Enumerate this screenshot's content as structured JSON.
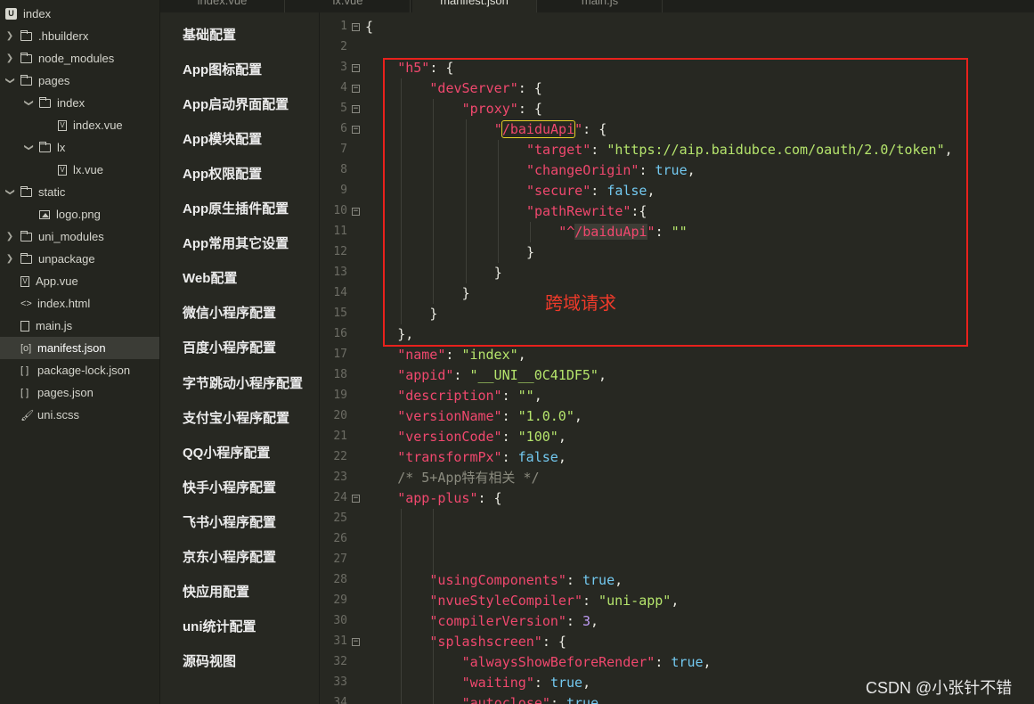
{
  "tabs": [
    {
      "label": "index.vue",
      "active": false
    },
    {
      "label": "lx.vue",
      "active": false
    },
    {
      "label": "manifest.json",
      "active": true
    },
    {
      "label": "main.js",
      "active": false
    }
  ],
  "file_tree": [
    {
      "label": "index",
      "icon": "project-root-icon",
      "depth": 0,
      "twisty": "none",
      "selected": false
    },
    {
      "label": ".hbuilderx",
      "icon": "folder-icon",
      "depth": 0,
      "twisty": "collapsed",
      "selected": false
    },
    {
      "label": "node_modules",
      "icon": "folder-icon",
      "depth": 0,
      "twisty": "collapsed",
      "selected": false
    },
    {
      "label": "pages",
      "icon": "folder-icon",
      "depth": 0,
      "twisty": "expanded",
      "selected": false
    },
    {
      "label": "index",
      "icon": "folder-icon",
      "depth": 1,
      "twisty": "expanded",
      "selected": false
    },
    {
      "label": "index.vue",
      "icon": "vue-file-icon",
      "depth": 2,
      "twisty": "none",
      "selected": false
    },
    {
      "label": "lx",
      "icon": "folder-icon",
      "depth": 1,
      "twisty": "expanded",
      "selected": false
    },
    {
      "label": "lx.vue",
      "icon": "vue-file-icon",
      "depth": 2,
      "twisty": "none",
      "selected": false
    },
    {
      "label": "static",
      "icon": "folder-icon",
      "depth": 0,
      "twisty": "expanded",
      "selected": false
    },
    {
      "label": "logo.png",
      "icon": "image-file-icon",
      "depth": 1,
      "twisty": "none",
      "selected": false
    },
    {
      "label": "uni_modules",
      "icon": "folder-icon",
      "depth": 0,
      "twisty": "collapsed",
      "selected": false
    },
    {
      "label": "unpackage",
      "icon": "folder-icon",
      "depth": 0,
      "twisty": "collapsed",
      "selected": false
    },
    {
      "label": "App.vue",
      "icon": "vue-file-icon",
      "depth": 0,
      "twisty": "none",
      "selected": false
    },
    {
      "label": "index.html",
      "icon": "html-file-icon",
      "depth": 0,
      "twisty": "none",
      "selected": false
    },
    {
      "label": "main.js",
      "icon": "js-file-icon",
      "depth": 0,
      "twisty": "none",
      "selected": false
    },
    {
      "label": "manifest.json",
      "icon": "manifest-file-icon",
      "depth": 0,
      "twisty": "none",
      "selected": true
    },
    {
      "label": "package-lock.json",
      "icon": "json-file-icon",
      "depth": 0,
      "twisty": "none",
      "selected": false
    },
    {
      "label": "pages.json",
      "icon": "json-file-icon",
      "depth": 0,
      "twisty": "none",
      "selected": false
    },
    {
      "label": "uni.scss",
      "icon": "scss-file-icon",
      "depth": 0,
      "twisty": "none",
      "selected": false
    }
  ],
  "settings_nav": [
    "基础配置",
    "App图标配置",
    "App启动界面配置",
    "App模块配置",
    "App权限配置",
    "App原生插件配置",
    "App常用其它设置",
    "Web配置",
    "微信小程序配置",
    "百度小程序配置",
    "字节跳动小程序配置",
    "支付宝小程序配置",
    "QQ小程序配置",
    "快手小程序配置",
    "飞书小程序配置",
    "京东小程序配置",
    "快应用配置",
    "uni统计配置",
    "源码视图"
  ],
  "editor": {
    "lines": [
      {
        "n": "1",
        "fold": true,
        "indent": 0,
        "tokens": [
          [
            "punc",
            "{"
          ]
        ]
      },
      {
        "n": "2",
        "fold": false,
        "indent": 0,
        "tokens": []
      },
      {
        "n": "3",
        "fold": true,
        "indent": 1,
        "tokens": [
          [
            "key",
            "\"h5\""
          ],
          [
            "punc",
            ": {"
          ]
        ]
      },
      {
        "n": "4",
        "fold": true,
        "indent": 2,
        "tokens": [
          [
            "key",
            "\"devServer\""
          ],
          [
            "punc",
            ": {"
          ]
        ]
      },
      {
        "n": "5",
        "fold": true,
        "indent": 3,
        "tokens": [
          [
            "key",
            "\"proxy\""
          ],
          [
            "punc",
            ": {"
          ]
        ]
      },
      {
        "n": "6",
        "fold": true,
        "indent": 4,
        "tokens": [
          [
            "key",
            "\""
          ],
          [
            "keybox",
            "/baiduApi"
          ],
          [
            "key",
            "\""
          ],
          [
            "punc",
            ": {"
          ]
        ]
      },
      {
        "n": "7",
        "fold": false,
        "indent": 5,
        "tokens": [
          [
            "key",
            "\"target\""
          ],
          [
            "punc",
            ": "
          ],
          [
            "str",
            "\"https://aip.baidubce.com/oauth/2.0/token\""
          ],
          [
            "punc",
            ","
          ]
        ]
      },
      {
        "n": "8",
        "fold": false,
        "indent": 5,
        "tokens": [
          [
            "key",
            "\"changeOrigin\""
          ],
          [
            "punc",
            ": "
          ],
          [
            "bool",
            "true"
          ],
          [
            "punc",
            ","
          ]
        ]
      },
      {
        "n": "9",
        "fold": false,
        "indent": 5,
        "tokens": [
          [
            "key",
            "\"secure\""
          ],
          [
            "punc",
            ": "
          ],
          [
            "bool",
            "false"
          ],
          [
            "punc",
            ","
          ]
        ]
      },
      {
        "n": "10",
        "fold": true,
        "indent": 5,
        "tokens": [
          [
            "key",
            "\"pathRewrite\""
          ],
          [
            "punc",
            ":{"
          ]
        ]
      },
      {
        "n": "11",
        "fold": false,
        "indent": 6,
        "tokens": [
          [
            "key",
            "\"^"
          ],
          [
            "keybg",
            "/baiduApi"
          ],
          [
            "key",
            "\""
          ],
          [
            "punc",
            ": "
          ],
          [
            "str",
            "\"\""
          ]
        ]
      },
      {
        "n": "12",
        "fold": false,
        "indent": 5,
        "tokens": [
          [
            "punc",
            "}"
          ]
        ]
      },
      {
        "n": "13",
        "fold": false,
        "indent": 4,
        "tokens": [
          [
            "punc",
            "}"
          ]
        ]
      },
      {
        "n": "14",
        "fold": false,
        "indent": 3,
        "tokens": [
          [
            "punc",
            "}"
          ]
        ]
      },
      {
        "n": "15",
        "fold": false,
        "indent": 2,
        "tokens": [
          [
            "punc",
            "}"
          ]
        ]
      },
      {
        "n": "16",
        "fold": false,
        "indent": 1,
        "tokens": [
          [
            "punc",
            "},"
          ]
        ]
      },
      {
        "n": "17",
        "fold": false,
        "indent": 1,
        "tokens": [
          [
            "key",
            "\"name\""
          ],
          [
            "punc",
            ": "
          ],
          [
            "str",
            "\"index\""
          ],
          [
            "punc",
            ","
          ]
        ]
      },
      {
        "n": "18",
        "fold": false,
        "indent": 1,
        "tokens": [
          [
            "key",
            "\"appid\""
          ],
          [
            "punc",
            ": "
          ],
          [
            "str",
            "\"__UNI__0C41DF5\""
          ],
          [
            "punc",
            ","
          ]
        ]
      },
      {
        "n": "19",
        "fold": false,
        "indent": 1,
        "tokens": [
          [
            "key",
            "\"description\""
          ],
          [
            "punc",
            ": "
          ],
          [
            "str",
            "\"\""
          ],
          [
            "punc",
            ","
          ]
        ]
      },
      {
        "n": "20",
        "fold": false,
        "indent": 1,
        "tokens": [
          [
            "key",
            "\"versionName\""
          ],
          [
            "punc",
            ": "
          ],
          [
            "str",
            "\"1.0.0\""
          ],
          [
            "punc",
            ","
          ]
        ]
      },
      {
        "n": "21",
        "fold": false,
        "indent": 1,
        "tokens": [
          [
            "key",
            "\"versionCode\""
          ],
          [
            "punc",
            ": "
          ],
          [
            "str",
            "\"100\""
          ],
          [
            "punc",
            ","
          ]
        ]
      },
      {
        "n": "22",
        "fold": false,
        "indent": 1,
        "tokens": [
          [
            "key",
            "\"transformPx\""
          ],
          [
            "punc",
            ": "
          ],
          [
            "bool",
            "false"
          ],
          [
            "punc",
            ","
          ]
        ]
      },
      {
        "n": "23",
        "fold": false,
        "indent": 1,
        "tokens": [
          [
            "comment",
            "/* 5+App特有相关 */"
          ]
        ]
      },
      {
        "n": "24",
        "fold": true,
        "indent": 1,
        "tokens": [
          [
            "key",
            "\"app-plus\""
          ],
          [
            "punc",
            ": {"
          ]
        ]
      },
      {
        "n": "25",
        "fold": false,
        "indent": 2,
        "tokens": []
      },
      {
        "n": "26",
        "fold": false,
        "indent": 2,
        "tokens": []
      },
      {
        "n": "27",
        "fold": false,
        "indent": 2,
        "tokens": []
      },
      {
        "n": "28",
        "fold": false,
        "indent": 2,
        "tokens": [
          [
            "key",
            "\"usingComponents\""
          ],
          [
            "punc",
            ": "
          ],
          [
            "bool",
            "true"
          ],
          [
            "punc",
            ","
          ]
        ]
      },
      {
        "n": "29",
        "fold": false,
        "indent": 2,
        "tokens": [
          [
            "key",
            "\"nvueStyleCompiler\""
          ],
          [
            "punc",
            ": "
          ],
          [
            "str",
            "\"uni-app\""
          ],
          [
            "punc",
            ","
          ]
        ]
      },
      {
        "n": "30",
        "fold": false,
        "indent": 2,
        "tokens": [
          [
            "key",
            "\"compilerVersion\""
          ],
          [
            "punc",
            ": "
          ],
          [
            "num",
            "3"
          ],
          [
            "punc",
            ","
          ]
        ]
      },
      {
        "n": "31",
        "fold": true,
        "indent": 2,
        "tokens": [
          [
            "key",
            "\"splashscreen\""
          ],
          [
            "punc",
            ": {"
          ]
        ]
      },
      {
        "n": "32",
        "fold": false,
        "indent": 3,
        "tokens": [
          [
            "key",
            "\"alwaysShowBeforeRender\""
          ],
          [
            "punc",
            ": "
          ],
          [
            "bool",
            "true"
          ],
          [
            "punc",
            ","
          ]
        ]
      },
      {
        "n": "33",
        "fold": false,
        "indent": 3,
        "tokens": [
          [
            "key",
            "\"waiting\""
          ],
          [
            "punc",
            ": "
          ],
          [
            "bool",
            "true"
          ],
          [
            "punc",
            ","
          ]
        ]
      },
      {
        "n": "34",
        "fold": false,
        "indent": 3,
        "tokens": [
          [
            "key",
            "\"autoclose\""
          ],
          [
            "punc",
            ": "
          ],
          [
            "bool",
            "true"
          ]
        ]
      }
    ]
  },
  "annotation": {
    "label": "跨域请求",
    "color": "#e8211c"
  },
  "watermark": "CSDN @小张针不错",
  "colors": {
    "key": "#f0486e",
    "string": "#b5e46c",
    "boolean": "#73c9f0",
    "number": "#bf9cf5",
    "comment": "#8b8b7f",
    "highlight": "#e6d227"
  }
}
